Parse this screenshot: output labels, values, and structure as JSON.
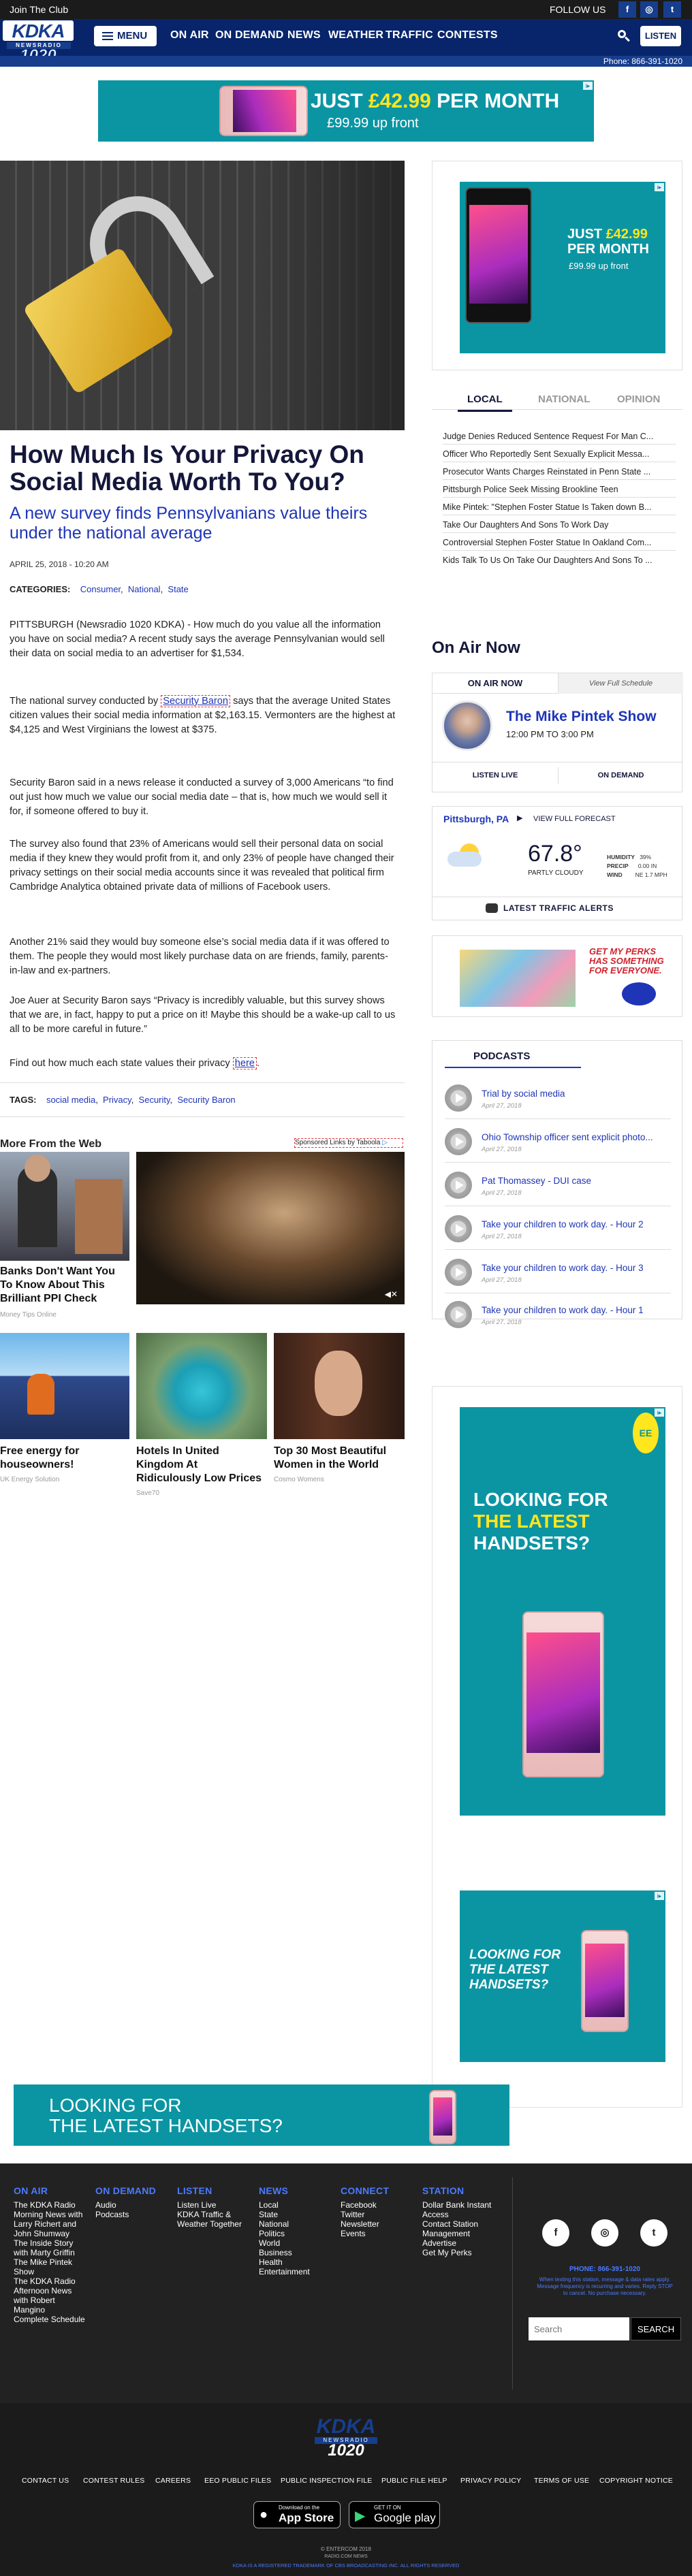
{
  "topbar": {
    "join": "Join The Club",
    "follow": "FOLLOW US",
    "social": [
      "f",
      "◎",
      "t"
    ]
  },
  "logo": {
    "kdka": "KDKA",
    "newsradio": "NEWSRADIO",
    "freq": "1020"
  },
  "nav": {
    "menu": "MENU",
    "items": [
      "ON AIR",
      "ON DEMAND",
      "NEWS",
      "WEATHER",
      "TRAFFIC",
      "CONTESTS"
    ],
    "listen": "LISTEN",
    "phone": "Phone: 866-391-1020"
  },
  "ads": {
    "top_price_prefix": "JUST",
    "top_price": "£42.99",
    "top_price_suffix": "PER MONTH",
    "top_upfront": "£99.99 up front",
    "side_price_prefix": "JUST",
    "side_price": "£42.99",
    "side_price_suffix": "PER MONTH",
    "side_upfront": "£99.99 up front",
    "looking1": "LOOKING FOR",
    "looking2": "THE LATEST",
    "looking3": "HANDSETS?",
    "looking_small1": "LOOKING FOR",
    "looking_small2": "THE LATEST",
    "looking_small3": "HANDSETS?",
    "banner_line1": "LOOKING FOR",
    "banner_line2": "THE LATEST HANDSETS?",
    "perks1": "GET MY PERKS",
    "perks2": "HAS SOMETHING",
    "perks3": "FOR EVERYONE.",
    "ee": "EE"
  },
  "article": {
    "title": "How Much Is Your Privacy On Social Media Worth To You?",
    "subtitle": "A new survey finds Pennsylvanians value theirs under the national average",
    "date": "APRIL 25, 2018 - 10:20 AM",
    "categories_label": "CATEGORIES:",
    "categories": [
      "Consumer",
      "National",
      "State"
    ],
    "p1": "PITTSBURGH (Newsradio 1020 KDKA) - How much do you value all the information you have on social media? A recent study says the average Pennsylvanian would sell their data on social media to an advertiser for $1,534.",
    "p2_a": "The national survey conducted by ",
    "p2_link": "Security Baron",
    "p2_b": " says that the average United States citizen values their social media information at $2,163.15. Vermonters are the highest at $4,125 and West Virginians the lowest at $375.",
    "p3": "Security Baron said in a news release it conducted a survey of 3,000 Americans “to find out just how much we value our social media date – that is, how much we would sell it for, if someone offered to buy it.",
    "p4": "The survey also found that 23% of Americans would sell their personal data on social media if they knew they would profit from it, and only 23% of  people have changed their privacy settings on their social media accounts since it was revealed that political firm Cambridge Analytica obtained private data of millions of Facebook users.",
    "p5": "Another 21% said they would buy someone else’s social media data if it was offered to them. The people they would most likely  purchase data on are friends, family, parents-in-law and ex-partners.",
    "p6": "Joe Auer at Security Baron says “Privacy is incredibly valuable, but this survey shows that we are, in fact, happy to put a price on it! Maybe this should be a wake-up call to us all to be more careful in future.”",
    "p7_a": "Find out how much each state values their privacy ",
    "p7_link": "here",
    "p7_b": ".",
    "tags_label": "TAGS:",
    "tags": [
      "social media",
      "Privacy",
      "Security",
      "Security Baron"
    ]
  },
  "more_from_web": {
    "heading": "More From the Web",
    "sponsored": "Sponsored Links by Taboola",
    "cards": [
      {
        "title": "Banks Don't Want You To Know About This Brilliant PPI Check",
        "source": "Money Tips Online"
      },
      {
        "title": "Free energy for houseowners!",
        "source": "UK Energy Solution"
      },
      {
        "title": "Hotels In United Kingdom At Ridiculously Low Prices",
        "source": "Save70"
      },
      {
        "title": "Top 30 Most Beautiful Women in the World",
        "source": "Cosmo Womens"
      }
    ]
  },
  "local_tabs": [
    "LOCAL",
    "NATIONAL",
    "OPINION"
  ],
  "local_news": [
    "Judge Denies Reduced Sentence Request For Man C...",
    "Officer Who Reportedly Sent Sexually Explicit Messa...",
    "Prosecutor Wants Charges Reinstated in Penn State ...",
    "Pittsburgh Police Seek Missing Brookline Teen",
    "Mike Pintek: \"Stephen Foster Statue Is Taken down B...",
    "Take Our Daughters And Sons To Work Day",
    "Controversial Stephen Foster Statue In Oakland Com...",
    "Kids Talk To Us On Take Our Daughters And Sons To ..."
  ],
  "on_air": {
    "heading": "On Air Now",
    "label": "ON AIR NOW",
    "schedule": "View Full Schedule",
    "show": "The Mike Pintek Show",
    "time": "12:00 PM TO 3:00 PM",
    "listen_live": "LISTEN LIVE",
    "on_demand": "ON DEMAND"
  },
  "weather": {
    "location": "Pittsburgh, PA",
    "forecast_link": "VIEW FULL FORECAST",
    "temp": "67.8°",
    "condition": "PARTLY CLOUDY",
    "humidity_label": "HUMIDITY",
    "humidity": "39%",
    "precip_label": "PRECIP",
    "precip": "0.00 IN",
    "wind_label": "WIND",
    "wind": "NE 1.7 MPH",
    "traffic": "LATEST TRAFFIC ALERTS"
  },
  "podcasts": {
    "heading": "PODCASTS",
    "items": [
      {
        "title": "Trial by social media",
        "date": "April 27, 2018"
      },
      {
        "title": "Ohio Township officer sent explicit photo...",
        "date": "April 27, 2018"
      },
      {
        "title": "Pat Thomassey - DUI case",
        "date": "April 27, 2018"
      },
      {
        "title": "Take your children to work day. - Hour 2",
        "date": "April 27, 2018"
      },
      {
        "title": "Take your children to work day. - Hour 3",
        "date": "April 27, 2018"
      },
      {
        "title": "Take your children to work day. - Hour 1",
        "date": "April 27, 2018"
      }
    ]
  },
  "footer": {
    "cols": [
      {
        "head": "ON AIR",
        "items": [
          "The KDKA Radio Morning News with Larry Richert and John Shumway",
          "The Inside Story with Marty Griffin",
          "The Mike Pintek Show",
          "The KDKA Radio Afternoon News with Robert Mangino",
          "Complete Schedule"
        ]
      },
      {
        "head": "ON DEMAND",
        "items": [
          "Audio",
          "Podcasts"
        ]
      },
      {
        "head": "LISTEN",
        "items": [
          "Listen Live",
          "KDKA Traffic & Weather Together"
        ]
      },
      {
        "head": "NEWS",
        "items": [
          "Local",
          "State",
          "National",
          "Politics",
          "World",
          "Business",
          "Health",
          "Entertainment"
        ]
      },
      {
        "head": "CONNECT",
        "items": [
          "Facebook",
          "Twitter",
          "Newsletter",
          "Events"
        ]
      },
      {
        "head": "STATION",
        "items": [
          "Dollar Bank Instant Access",
          "Contact Station Management",
          "Advertise",
          "Get My Perks"
        ]
      }
    ],
    "phone": "PHONE: 866-391-1020",
    "smallprint": "When texting this station, message & data rates apply. Message frequency is recurring and varies. Reply STOP to cancel. No purchase necessary.",
    "search_placeholder": "Search",
    "search_button": "SEARCH"
  },
  "bottom": {
    "links": [
      "CONTACT US",
      "CONTEST RULES",
      "CAREERS",
      "EEO PUBLIC FILES",
      "PUBLIC INSPECTION FILE",
      "PUBLIC FILE HELP",
      "PRIVACY POLICY",
      "TERMS OF USE",
      "COPYRIGHT NOTICE"
    ],
    "appstore_small": "Download on the",
    "appstore": "App Store",
    "gplay_small": "GET IT ON",
    "gplay": "Google play",
    "copyright": "© ENTERCOM 2018",
    "radiocom": "RADIO.COM NEWS",
    "trademark": "KDKA IS A REGISTERED TRADEMARK OF CBS BROADCASTING INC. ALL RIGHTS RESERVED"
  }
}
